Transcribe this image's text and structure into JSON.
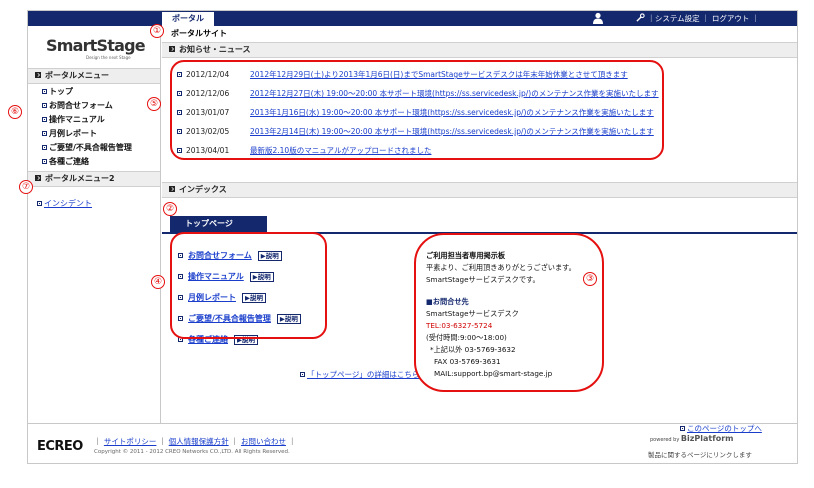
{
  "topbar": {
    "tab_label": "ポータル",
    "links_text": "｜システム設定 ｜ ログアウト ｜"
  },
  "logo": {
    "name": "SmartStage",
    "tagline": "Design the next Stage"
  },
  "sidebar": {
    "menu1_title": "ポータルメニュー",
    "items": [
      {
        "label": "トップ"
      },
      {
        "label": "お問合せフォーム"
      },
      {
        "label": "操作マニュアル"
      },
      {
        "label": "月例レポート"
      },
      {
        "label": "ご要望/不具合報告管理"
      },
      {
        "label": "各種ご連絡"
      }
    ],
    "menu2_title": "ポータルメニュー2",
    "incident_label": "インシデント"
  },
  "main": {
    "page_title": "ポータルサイト",
    "news_header": "お知らせ・ニュース",
    "news": [
      {
        "date": "2012/12/04",
        "title": "2012年12月29日(土)より2013年1月6日(日)までSmartStageサービスデスクは年末年始休業とさせて頂きます"
      },
      {
        "date": "2012/12/06",
        "title": "2012年12月27日(木) 19:00～20:00 本サポート環境(https://ss.servicedesk.jp/)のメンテナンス作業を実施いたします"
      },
      {
        "date": "2013/01/07",
        "title": "2013年1月16日(水) 19:00～20:00 本サポート環境(https://ss.servicedesk.jp/)のメンテナンス作業を実施いたします"
      },
      {
        "date": "2013/02/05",
        "title": "2013年2月14日(木) 19:00～20:00 本サポート環境(https://ss.servicedesk.jp/)のメンテナンス作業を実施いたします"
      },
      {
        "date": "2013/04/01",
        "title": "最新版2.10版のマニュアルがアップロードされました"
      }
    ],
    "index_header": "インデックス",
    "toppage_tab": "トップページ",
    "quick_links": [
      {
        "label": "お問合せフォーム",
        "explain": "▶説明"
      },
      {
        "label": "操作マニュアル",
        "explain": "▶説明"
      },
      {
        "label": "月例レポート",
        "explain": "▶説明"
      },
      {
        "label": "ご要望/不具合報告管理",
        "explain": "▶説明"
      },
      {
        "label": "各種ご連絡",
        "explain": "▶説明"
      }
    ],
    "notice": {
      "title": "ご利用担当者専用掲示板",
      "line1": "平素より、ご利用頂きありがとうございます。",
      "line2": "SmartStageサービスデスクです。",
      "inquiry_title": "■お問合せ先",
      "desk": "SmartStageサービスデスク",
      "tel": "TEL:03-6327-5724",
      "hours": "(受付時間:9:00～18:00)",
      "other": "*上記以外 03-5769-3632",
      "fax": "FAX 03-5769-3631",
      "mail": "MAIL:support.bp@smart-stage.jp"
    },
    "detail_link": "「トップページ」の詳細はこちら",
    "page_top_link": "このページのトップへ"
  },
  "footer": {
    "brand": "ECREO",
    "link1": "サイトポリシー",
    "link2": "個人情報保護方針",
    "link3": "お問い合わせ",
    "copyright": "Copyright © 2011 - 2012 CREO Networks CO.,LTD. All Rights Reserved.",
    "powered": "powered by",
    "platform": "BizPlatform",
    "link_note": "製品に関するページにリンクします"
  },
  "annotations": [
    "①",
    "②",
    "③",
    "④",
    "⑤",
    "⑥",
    "⑦"
  ],
  "colors": {
    "navy": "#14286e",
    "link": "#1a3ecb",
    "annotation_red": "#e51010"
  }
}
